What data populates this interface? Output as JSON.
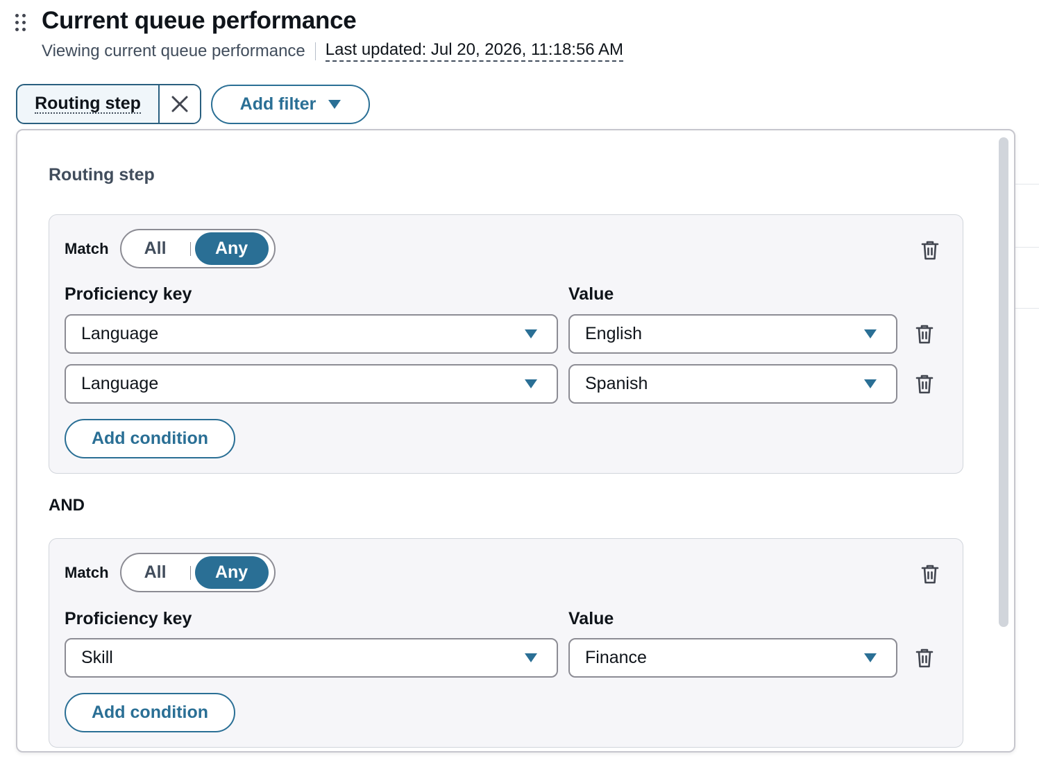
{
  "header": {
    "title": "Current queue performance",
    "subtitle": "Viewing current queue performance",
    "last_updated": "Last updated: Jul 20, 2026, 11:18:56 AM"
  },
  "filters": {
    "token_label": "Routing step",
    "add_filter_label": "Add filter"
  },
  "popover": {
    "title": "Routing step",
    "and_label": "AND",
    "groups": [
      {
        "match_label": "Match",
        "options": [
          "All",
          "Any"
        ],
        "selected": "Any",
        "key_header": "Proficiency key",
        "value_header": "Value",
        "conditions": [
          {
            "key": "Language",
            "value": "English"
          },
          {
            "key": "Language",
            "value": "Spanish"
          }
        ],
        "add_condition_label": "Add condition"
      },
      {
        "match_label": "Match",
        "options": [
          "All",
          "Any"
        ],
        "selected": "Any",
        "key_header": "Proficiency key",
        "value_header": "Value",
        "conditions": [
          {
            "key": "Skill",
            "value": "Finance"
          }
        ],
        "add_condition_label": "Add condition"
      }
    ]
  },
  "colors": {
    "accent": "#2a6f95",
    "group_bg": "#f6f6f9",
    "border": "#8c8c94"
  },
  "icons": [
    "drag-handle-icon",
    "close-icon",
    "caret-down-icon",
    "trash-icon"
  ]
}
